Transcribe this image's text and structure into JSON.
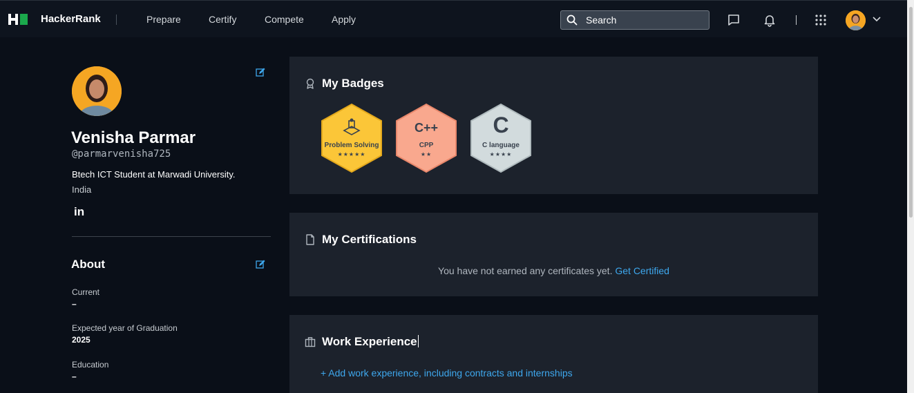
{
  "nav": {
    "logo_text": "HackerRank",
    "links": [
      "Prepare",
      "Certify",
      "Compete",
      "Apply"
    ],
    "search_placeholder": "Search"
  },
  "profile": {
    "name": "Venisha Parmar",
    "username": "@parmarvenisha725",
    "bio": "Btech ICT Student at Marwadi University.",
    "country": "India",
    "linkedin": "in"
  },
  "about": {
    "title": "About",
    "fields": [
      {
        "label": "Current",
        "value": "–"
      },
      {
        "label": "Expected year of Graduation",
        "value": "2025"
      },
      {
        "label": "Education",
        "value": "–"
      }
    ]
  },
  "badges": {
    "title": "My Badges",
    "items": [
      {
        "name": "Problem Solving",
        "stars": "★★★★★",
        "stars_count": 5,
        "color": "#fbc638"
      },
      {
        "name": "CPP",
        "stars": "★★",
        "stars_count": 2,
        "symbol": "C++",
        "color": "#f9a88e"
      },
      {
        "name": "C language",
        "stars": "★★★★",
        "stars_count": 4,
        "symbol": "C",
        "color": "#d2dbdd"
      }
    ]
  },
  "certifications": {
    "title": "My Certifications",
    "message": "You have not earned any certificates yet.",
    "link": "Get Certified"
  },
  "work": {
    "title": "Work Experience",
    "add_link": "+ Add work experience, including contracts and internships"
  },
  "colors": {
    "background": "#0a0f18",
    "card": "#1c222c",
    "nav": "#0e141e",
    "link": "#3ea8ee",
    "brand_green": "#1ba94c"
  }
}
